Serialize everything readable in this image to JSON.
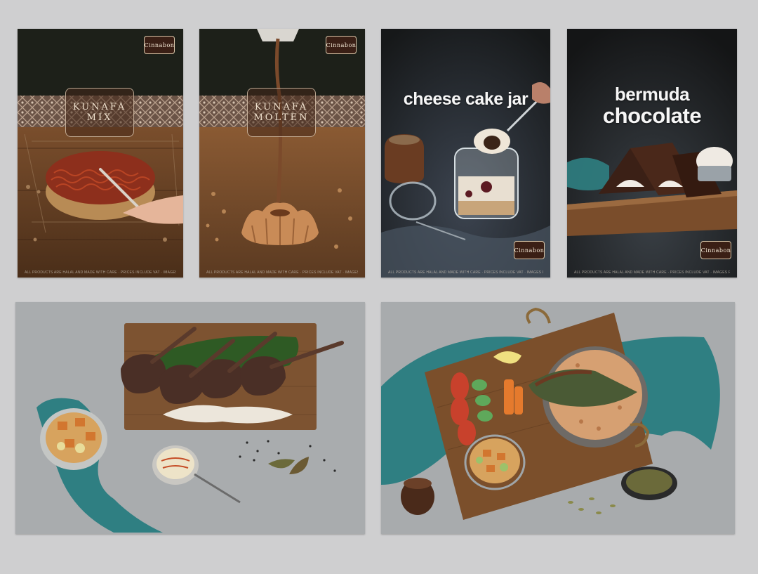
{
  "posters": [
    {
      "title_line1": "KUNAFA",
      "title_line2": "MIX",
      "logo": "Cinnabon",
      "footer": "ALL PRODUCTS ARE HALAL AND MADE WITH CARE · PRICES INCLUDE VAT · IMAGES FOR ILLUSTRATION ONLY"
    },
    {
      "title_line1": "KUNAFA",
      "title_line2": "MOLTEN",
      "logo": "Cinnabon",
      "footer": "ALL PRODUCTS ARE HALAL AND MADE WITH CARE · PRICES INCLUDE VAT · IMAGES FOR ILLUSTRATION ONLY"
    },
    {
      "title_line1": "cheese cake jar",
      "logo": "Cinnabon",
      "footer": "ALL PRODUCTS ARE HALAL AND MADE WITH CARE · PRICES INCLUDE VAT · IMAGES FOR ILLUSTRATION ONLY"
    },
    {
      "title_line1": "bermuda",
      "title_line2": "chocolate",
      "logo": "Cinnabon",
      "footer": "ALL PRODUCTS ARE HALAL AND MADE WITH CARE · PRICES INCLUDE VAT · IMAGES FOR ILLUSTRATION ONLY"
    }
  ],
  "photos": [
    {
      "subject": "lamb-chops"
    },
    {
      "subject": "rice-platter"
    }
  ],
  "colors": {
    "background": "#cfcfd0",
    "teal_cloth": "#2f7f82",
    "wood": "#8a5a36",
    "dark_bg": "#1f1f1f"
  }
}
